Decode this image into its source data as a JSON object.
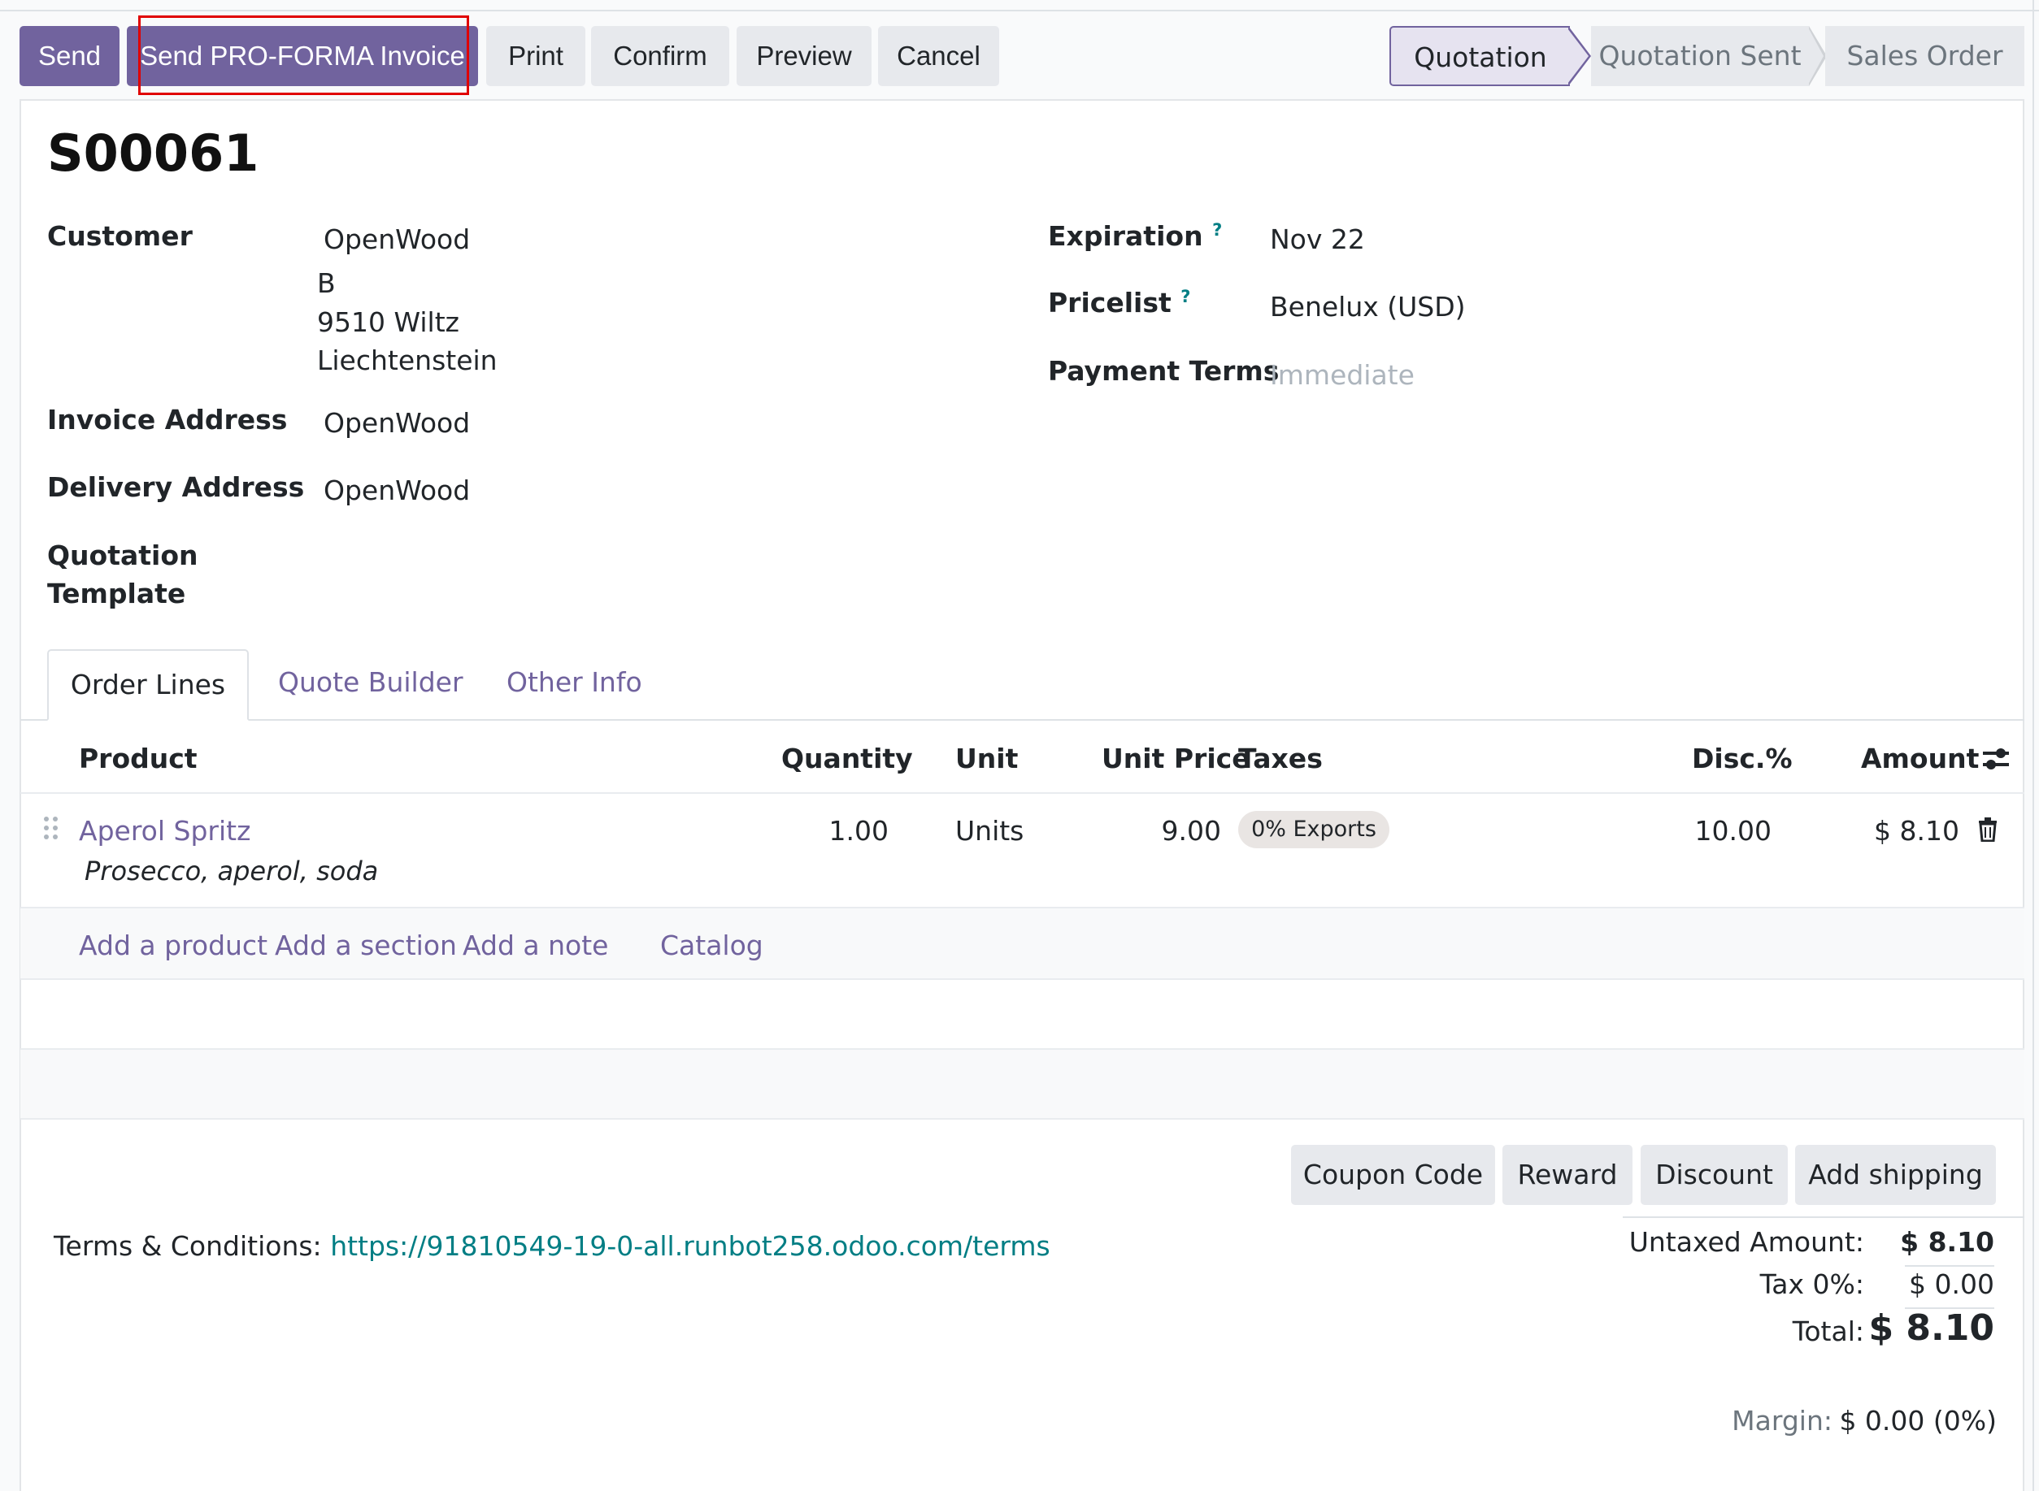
{
  "actions": {
    "send": "Send",
    "send_proforma": "Send PRO-FORMA Invoice",
    "print": "Print",
    "confirm": "Confirm",
    "preview": "Preview",
    "cancel": "Cancel"
  },
  "statusbar": {
    "stages": [
      "Quotation",
      "Quotation Sent",
      "Sales Order"
    ],
    "current": "Quotation"
  },
  "record": {
    "name": "S00061",
    "customer_label": "Customer",
    "customer_name": "OpenWood",
    "customer_address": [
      "B",
      "9510 Wiltz",
      "Liechtenstein"
    ],
    "invoice_address_label": "Invoice Address",
    "invoice_address": "OpenWood",
    "delivery_address_label": "Delivery Address",
    "delivery_address": "OpenWood",
    "quotation_template_label_1": "Quotation",
    "quotation_template_label_2": "Template",
    "expiration_label": "Expiration",
    "expiration": "Nov 22",
    "pricelist_label": "Pricelist",
    "pricelist": "Benelux (USD)",
    "payment_terms_label": "Payment Terms",
    "payment_terms_placeholder": "Immediate",
    "help_mark": "?"
  },
  "tabs": [
    "Order Lines",
    "Quote Builder",
    "Other Info"
  ],
  "order_lines": {
    "headers": {
      "product": "Product",
      "quantity": "Quantity",
      "unit": "Unit",
      "unit_price": "Unit Price",
      "taxes": "Taxes",
      "discount": "Disc.%",
      "amount": "Amount"
    },
    "rows": [
      {
        "product": "Aperol Spritz",
        "description": "Prosecco, aperol, soda",
        "quantity": "1.00",
        "unit": "Units",
        "unit_price": "9.00",
        "tax": "0% Exports",
        "discount": "10.00",
        "amount": "$ 8.10"
      }
    ],
    "add_links": {
      "product": "Add a product",
      "section": "Add a section",
      "note": "Add a note",
      "catalog": "Catalog"
    }
  },
  "footer": {
    "buttons": [
      "Coupon Code",
      "Reward",
      "Discount",
      "Add shipping"
    ],
    "terms_label": "Terms & Conditions:",
    "terms_url": "https://91810549-19-0-all.runbot258.odoo.com/terms",
    "untaxed_label": "Untaxed Amount:",
    "untaxed_value": "$ 8.10",
    "tax_label": "Tax 0%:",
    "tax_value": "$ 0.00",
    "total_label": "Total:",
    "total_value": "$ 8.10",
    "margin_label": "Margin:",
    "margin_value": "$ 0.00 (0%)"
  },
  "colors": {
    "primary": "#71639e",
    "link_teal": "#017e84",
    "highlight": "#e00000"
  }
}
